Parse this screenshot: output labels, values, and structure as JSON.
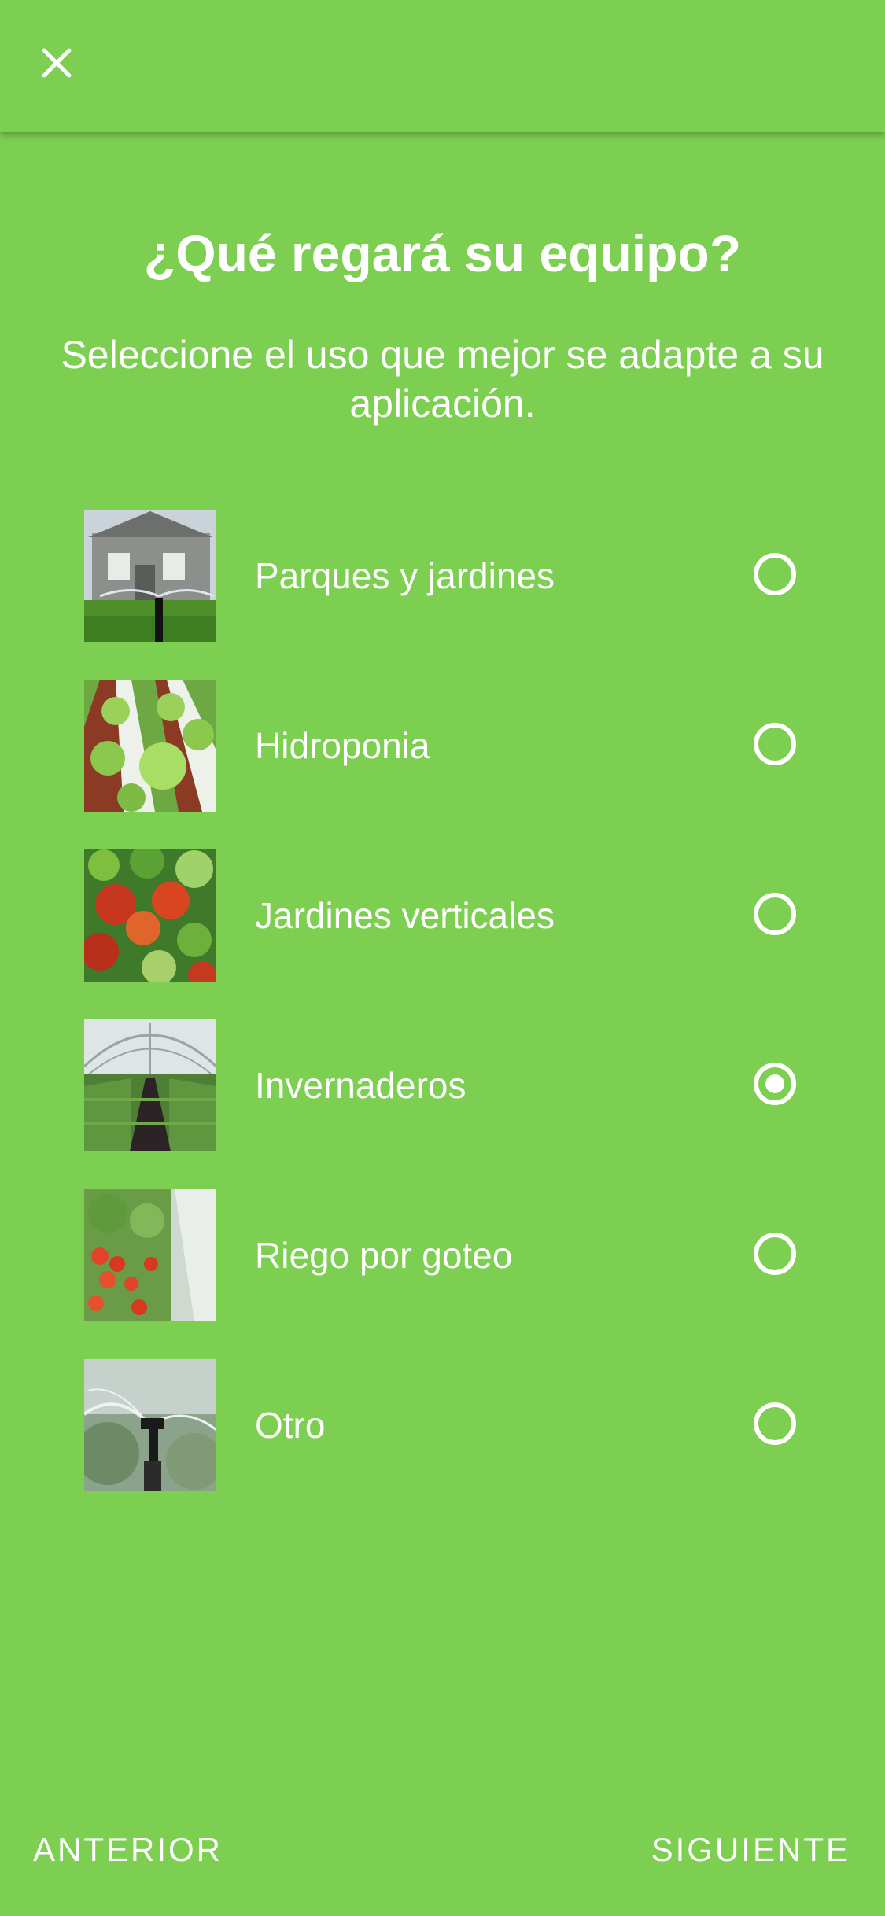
{
  "header": {
    "close_icon": "close-icon"
  },
  "question": {
    "title": "¿Qué regará su equipo?",
    "subtitle": "Seleccione el uso que mejor se adapte a su aplicación."
  },
  "options": [
    {
      "label": "Parques y jardines",
      "image": "park-sprinkler-image",
      "selected": false
    },
    {
      "label": "Hidroponia",
      "image": "hydroponic-lettuce-image",
      "selected": false
    },
    {
      "label": "Jardines verticales",
      "image": "vertical-garden-image",
      "selected": false
    },
    {
      "label": "Invernaderos",
      "image": "greenhouse-image",
      "selected": true
    },
    {
      "label": "Riego por goteo",
      "image": "drip-tomato-image",
      "selected": false
    },
    {
      "label": "Otro",
      "image": "sprinkler-head-image",
      "selected": false
    }
  ],
  "footer": {
    "prev_label": "ANTERIOR",
    "next_label": "SIGUIENTE"
  },
  "colors": {
    "background": "#7ccf50",
    "text": "#ffffff"
  }
}
